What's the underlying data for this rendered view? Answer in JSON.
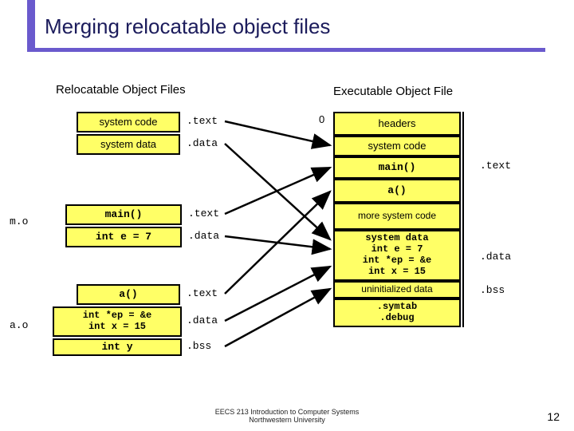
{
  "title": "Merging relocatable object files",
  "headings": {
    "left": "Relocatable Object Files",
    "right": "Executable Object File"
  },
  "left": {
    "system_code": "system code",
    "system_data": "system data",
    "main": "main()",
    "int_e": "int e = 7",
    "a": "a()",
    "ao_data": "int *ep = &e\nint x = 15",
    "ao_bss": "int y"
  },
  "sections": {
    "text": ".text",
    "data": ".data",
    "bss": ".bss"
  },
  "files": {
    "mo": "m.o",
    "ao": "a.o"
  },
  "zero": "0",
  "right": {
    "headers": "headers",
    "system_code": "system code",
    "main": "main()",
    "a": "a()",
    "more_sys": "more system code",
    "data_block": "system data\nint e = 7\nint *ep = &e\nint x = 15",
    "uninit": "uninitialized data",
    "symdbg": ".symtab\n.debug"
  },
  "right_sections": {
    "text": ".text",
    "data": ".data",
    "bss": ".bss"
  },
  "footer": {
    "line1": "EECS 213 Introduction to Computer Systems",
    "line2": "Northwestern University"
  },
  "page": "12"
}
